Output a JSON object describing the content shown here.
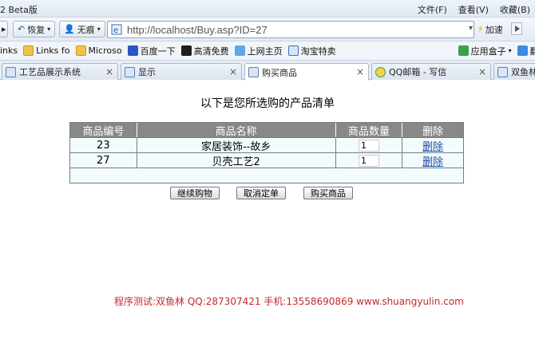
{
  "window": {
    "title": "2 Beta版",
    "menus": [
      "文件(F)",
      "查看(V)",
      "收藏(B)"
    ]
  },
  "toolbar": {
    "restore_label": "恢复",
    "notrace_label": "无痕",
    "url": "http://localhost/Buy.asp?ID=27",
    "speed_label": "加速"
  },
  "favorites": [
    {
      "label": "inks",
      "icon": "folder-icon"
    },
    {
      "label": "Links fo",
      "icon": "folder-icon"
    },
    {
      "label": "Microso",
      "icon": "folder-icon"
    },
    {
      "label": "百度一下",
      "icon": "baidu-icon"
    },
    {
      "label": "高清免费",
      "icon": "m-icon"
    },
    {
      "label": "上网主页",
      "icon": "home-icon"
    },
    {
      "label": "淘宝特卖",
      "icon": "ie-icon"
    },
    {
      "label": "应用盒子",
      "icon": "apps-icon"
    },
    {
      "label": "翻译",
      "icon": "translate-icon"
    }
  ],
  "tabs": [
    {
      "label": "工艺品展示系统",
      "active": false
    },
    {
      "label": "显示",
      "active": false
    },
    {
      "label": "购买商品",
      "active": true
    },
    {
      "label": "QQ邮箱 - 写信",
      "active": false
    },
    {
      "label": "双鱼林",
      "active": false
    }
  ],
  "page": {
    "heading": "以下是您所选购的产品清单",
    "columns": [
      "商品编号",
      "商品名称",
      "商品数量",
      "删除"
    ],
    "rows": [
      {
        "id": "23",
        "name": "家居装饰--故乡",
        "qty": "1",
        "delete": "删除"
      },
      {
        "id": "27",
        "name": "贝壳工艺2",
        "qty": "1",
        "delete": "删除"
      }
    ],
    "buttons": {
      "continue": "继续购物",
      "cancel": "取消定单",
      "buy": "购买商品"
    },
    "footer": "程序测试:双鱼林 QQ:287307421 手机:13558690869 www.shuangyulin.com"
  }
}
